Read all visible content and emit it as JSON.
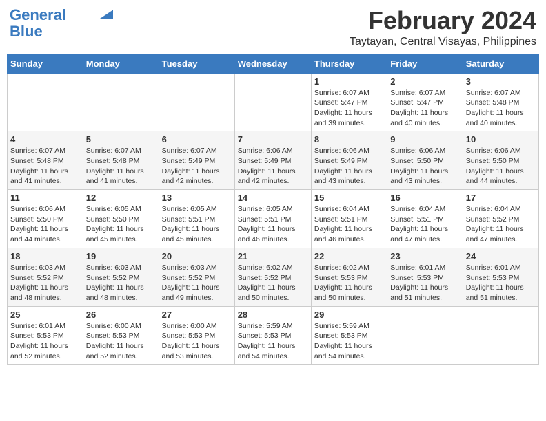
{
  "header": {
    "logo_line1": "General",
    "logo_line2": "Blue",
    "month_title": "February 2024",
    "location": "Taytayan, Central Visayas, Philippines"
  },
  "days_of_week": [
    "Sunday",
    "Monday",
    "Tuesday",
    "Wednesday",
    "Thursday",
    "Friday",
    "Saturday"
  ],
  "weeks": [
    [
      {
        "day": "",
        "info": ""
      },
      {
        "day": "",
        "info": ""
      },
      {
        "day": "",
        "info": ""
      },
      {
        "day": "",
        "info": ""
      },
      {
        "day": "1",
        "info": "Sunrise: 6:07 AM\nSunset: 5:47 PM\nDaylight: 11 hours\nand 39 minutes."
      },
      {
        "day": "2",
        "info": "Sunrise: 6:07 AM\nSunset: 5:47 PM\nDaylight: 11 hours\nand 40 minutes."
      },
      {
        "day": "3",
        "info": "Sunrise: 6:07 AM\nSunset: 5:48 PM\nDaylight: 11 hours\nand 40 minutes."
      }
    ],
    [
      {
        "day": "4",
        "info": "Sunrise: 6:07 AM\nSunset: 5:48 PM\nDaylight: 11 hours\nand 41 minutes."
      },
      {
        "day": "5",
        "info": "Sunrise: 6:07 AM\nSunset: 5:48 PM\nDaylight: 11 hours\nand 41 minutes."
      },
      {
        "day": "6",
        "info": "Sunrise: 6:07 AM\nSunset: 5:49 PM\nDaylight: 11 hours\nand 42 minutes."
      },
      {
        "day": "7",
        "info": "Sunrise: 6:06 AM\nSunset: 5:49 PM\nDaylight: 11 hours\nand 42 minutes."
      },
      {
        "day": "8",
        "info": "Sunrise: 6:06 AM\nSunset: 5:49 PM\nDaylight: 11 hours\nand 43 minutes."
      },
      {
        "day": "9",
        "info": "Sunrise: 6:06 AM\nSunset: 5:50 PM\nDaylight: 11 hours\nand 43 minutes."
      },
      {
        "day": "10",
        "info": "Sunrise: 6:06 AM\nSunset: 5:50 PM\nDaylight: 11 hours\nand 44 minutes."
      }
    ],
    [
      {
        "day": "11",
        "info": "Sunrise: 6:06 AM\nSunset: 5:50 PM\nDaylight: 11 hours\nand 44 minutes."
      },
      {
        "day": "12",
        "info": "Sunrise: 6:05 AM\nSunset: 5:50 PM\nDaylight: 11 hours\nand 45 minutes."
      },
      {
        "day": "13",
        "info": "Sunrise: 6:05 AM\nSunset: 5:51 PM\nDaylight: 11 hours\nand 45 minutes."
      },
      {
        "day": "14",
        "info": "Sunrise: 6:05 AM\nSunset: 5:51 PM\nDaylight: 11 hours\nand 46 minutes."
      },
      {
        "day": "15",
        "info": "Sunrise: 6:04 AM\nSunset: 5:51 PM\nDaylight: 11 hours\nand 46 minutes."
      },
      {
        "day": "16",
        "info": "Sunrise: 6:04 AM\nSunset: 5:51 PM\nDaylight: 11 hours\nand 47 minutes."
      },
      {
        "day": "17",
        "info": "Sunrise: 6:04 AM\nSunset: 5:52 PM\nDaylight: 11 hours\nand 47 minutes."
      }
    ],
    [
      {
        "day": "18",
        "info": "Sunrise: 6:03 AM\nSunset: 5:52 PM\nDaylight: 11 hours\nand 48 minutes."
      },
      {
        "day": "19",
        "info": "Sunrise: 6:03 AM\nSunset: 5:52 PM\nDaylight: 11 hours\nand 48 minutes."
      },
      {
        "day": "20",
        "info": "Sunrise: 6:03 AM\nSunset: 5:52 PM\nDaylight: 11 hours\nand 49 minutes."
      },
      {
        "day": "21",
        "info": "Sunrise: 6:02 AM\nSunset: 5:52 PM\nDaylight: 11 hours\nand 50 minutes."
      },
      {
        "day": "22",
        "info": "Sunrise: 6:02 AM\nSunset: 5:53 PM\nDaylight: 11 hours\nand 50 minutes."
      },
      {
        "day": "23",
        "info": "Sunrise: 6:01 AM\nSunset: 5:53 PM\nDaylight: 11 hours\nand 51 minutes."
      },
      {
        "day": "24",
        "info": "Sunrise: 6:01 AM\nSunset: 5:53 PM\nDaylight: 11 hours\nand 51 minutes."
      }
    ],
    [
      {
        "day": "25",
        "info": "Sunrise: 6:01 AM\nSunset: 5:53 PM\nDaylight: 11 hours\nand 52 minutes."
      },
      {
        "day": "26",
        "info": "Sunrise: 6:00 AM\nSunset: 5:53 PM\nDaylight: 11 hours\nand 52 minutes."
      },
      {
        "day": "27",
        "info": "Sunrise: 6:00 AM\nSunset: 5:53 PM\nDaylight: 11 hours\nand 53 minutes."
      },
      {
        "day": "28",
        "info": "Sunrise: 5:59 AM\nSunset: 5:53 PM\nDaylight: 11 hours\nand 54 minutes."
      },
      {
        "day": "29",
        "info": "Sunrise: 5:59 AM\nSunset: 5:53 PM\nDaylight: 11 hours\nand 54 minutes."
      },
      {
        "day": "",
        "info": ""
      },
      {
        "day": "",
        "info": ""
      }
    ]
  ]
}
